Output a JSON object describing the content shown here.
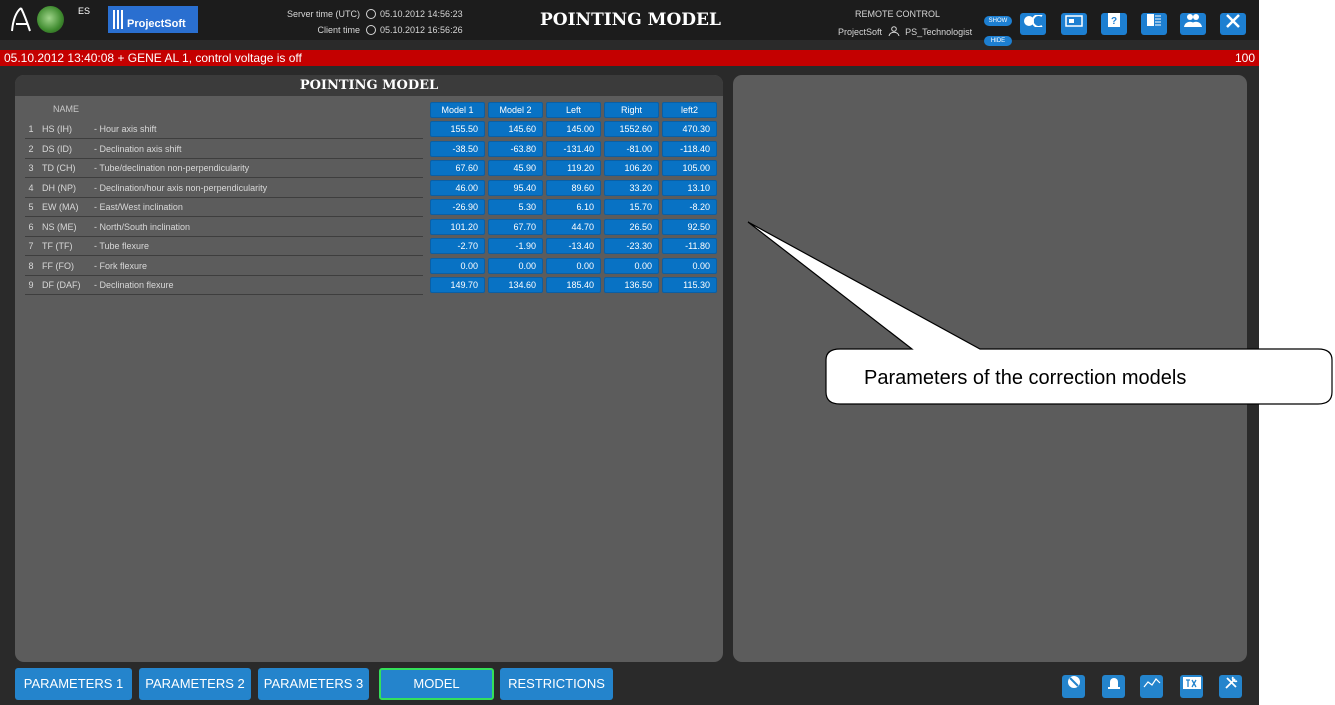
{
  "header": {
    "logo_es_text": "ES",
    "logo_text": "ProjectSoft",
    "server_time_label": "Server time (UTC)",
    "server_time": "05.10.2012 14:56:23",
    "client_time_label": "Client time",
    "client_time": "05.10.2012 16:56:26",
    "title": "POINTING MODEL",
    "remote_label": "REMOTE CONTROL",
    "remote_company": "ProjectSoft",
    "remote_user": "PS_Technologist",
    "show_label": "SHOW",
    "hide_label": "HIDE",
    "icons": [
      "dome-icon",
      "screen-icon",
      "help-icon",
      "document-icon",
      "users-icon",
      "tools-icon"
    ]
  },
  "alarm": {
    "message": "05.10.2012 13:40:08  +  GENE AL 1, control voltage is off",
    "count": "100"
  },
  "panel": {
    "title": "POINTING MODEL",
    "name_header": "NAME",
    "columns": [
      "Model 1",
      "Model 2",
      "Left",
      "Right",
      "left2"
    ],
    "rows": [
      {
        "num": "1",
        "code": "HS (IH)",
        "desc": "- Hour axis shift",
        "values": [
          "155.50",
          "145.60",
          "145.00",
          "1552.60",
          "470.30"
        ]
      },
      {
        "num": "2",
        "code": "DS (ID)",
        "desc": "- Declination axis shift",
        "values": [
          "-38.50",
          "-63.80",
          "-131.40",
          "-81.00",
          "-118.40"
        ]
      },
      {
        "num": "3",
        "code": "TD (CH)",
        "desc": "- Tube/declination non-perpendicularity",
        "values": [
          "67.60",
          "45.90",
          "119.20",
          "106.20",
          "105.00"
        ]
      },
      {
        "num": "4",
        "code": "DH (NP)",
        "desc": "- Declination/hour axis non-perpendicularity",
        "values": [
          "46.00",
          "95.40",
          "89.60",
          "33.20",
          "13.10"
        ]
      },
      {
        "num": "5",
        "code": "EW (MA)",
        "desc": "- East/West inclination",
        "values": [
          "-26.90",
          "5.30",
          "6.10",
          "15.70",
          "-8.20"
        ]
      },
      {
        "num": "6",
        "code": "NS (ME)",
        "desc": "- North/South inclination",
        "values": [
          "101.20",
          "67.70",
          "44.70",
          "26.50",
          "92.50"
        ]
      },
      {
        "num": "7",
        "code": "TF (TF)",
        "desc": "- Tube flexure",
        "values": [
          "-2.70",
          "-1.90",
          "-13.40",
          "-23.30",
          "-11.80"
        ]
      },
      {
        "num": "8",
        "code": "FF (FO)",
        "desc": "- Fork flexure",
        "values": [
          "0.00",
          "0.00",
          "0.00",
          "0.00",
          "0.00"
        ]
      },
      {
        "num": "9",
        "code": "DF (DAF)",
        "desc": "- Declination flexure",
        "values": [
          "149.70",
          "134.60",
          "185.40",
          "136.50",
          "115.30"
        ]
      }
    ]
  },
  "tabs": [
    {
      "label": "PARAMETERS 1",
      "active": false
    },
    {
      "label": "PARAMETERS 2",
      "active": false
    },
    {
      "label": "PARAMETERS 3",
      "active": false
    },
    {
      "label": "MODEL",
      "active": true
    },
    {
      "label": "RESTRICTIONS",
      "active": false
    }
  ],
  "bottom_icons": [
    "no-entry-icon",
    "alarm-light-icon",
    "trend-icon",
    "text-icon",
    "settings-tools-icon"
  ],
  "callout": {
    "text": "Parameters of the correction models"
  },
  "colors": {
    "accent_blue": "#2484cc",
    "alarm_red": "#c40000",
    "active_green": "#34e05a",
    "panel_gray": "#5c5c5c"
  }
}
